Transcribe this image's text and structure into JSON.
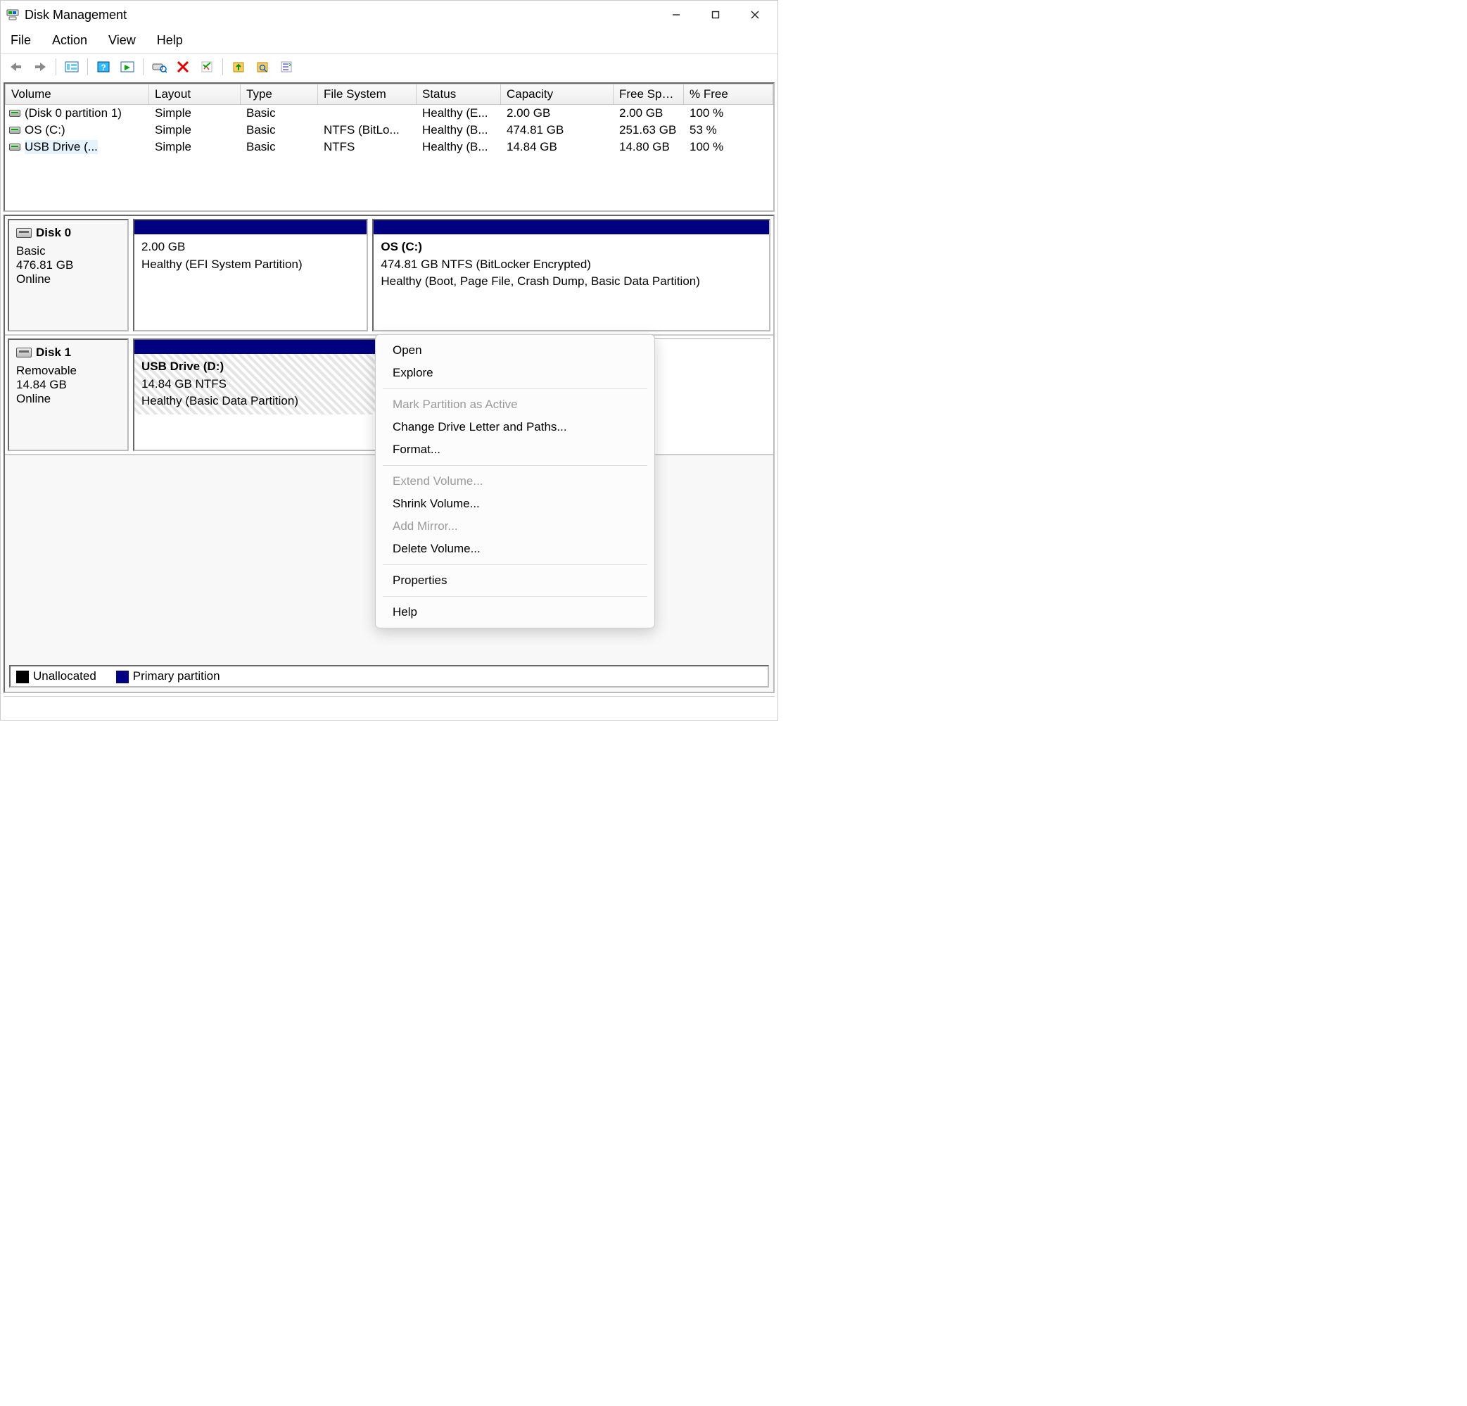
{
  "window": {
    "title": "Disk Management"
  },
  "menubar": [
    "File",
    "Action",
    "View",
    "Help"
  ],
  "columns": [
    "Volume",
    "Layout",
    "Type",
    "File System",
    "Status",
    "Capacity",
    "Free Spa...",
    "% Free"
  ],
  "volumes": [
    {
      "name": "(Disk 0 partition 1)",
      "layout": "Simple",
      "type": "Basic",
      "fs": "",
      "status": "Healthy (E...",
      "capacity": "2.00 GB",
      "free": "2.00 GB",
      "pct": "100 %",
      "selected": false
    },
    {
      "name": "OS (C:)",
      "layout": "Simple",
      "type": "Basic",
      "fs": "NTFS (BitLo...",
      "status": "Healthy (B...",
      "capacity": "474.81 GB",
      "free": "251.63 GB",
      "pct": "53 %",
      "selected": false
    },
    {
      "name": "USB Drive (...",
      "layout": "Simple",
      "type": "Basic",
      "fs": "NTFS",
      "status": "Healthy (B...",
      "capacity": "14.84 GB",
      "free": "14.80 GB",
      "pct": "100 %",
      "selected": true
    }
  ],
  "disks": [
    {
      "name": "Disk 0",
      "basic": "Basic",
      "size": "476.81 GB",
      "status": "Online",
      "parts": [
        {
          "title": "",
          "line1": "2.00 GB",
          "line2": "Healthy (EFI System Partition)",
          "grow": 1
        },
        {
          "title": "OS  (C:)",
          "line1": "474.81 GB NTFS (BitLocker Encrypted)",
          "line2": "Healthy (Boot, Page File, Crash Dump, Basic Data Partition)",
          "grow": 1.7
        }
      ]
    },
    {
      "name": "Disk 1",
      "basic": "Removable",
      "size": "14.84 GB",
      "status": "Online",
      "parts": [
        {
          "title": "USB Drive  (D:)",
          "line1": "14.84 GB NTFS",
          "line2": "Healthy (Basic Data Partition)",
          "grow": 3,
          "hatched": true
        }
      ],
      "trailing_empty": true
    }
  ],
  "legend": {
    "unallocated": "Unallocated",
    "primary": "Primary partition"
  },
  "context_menu": [
    {
      "label": "Open",
      "enabled": true
    },
    {
      "label": "Explore",
      "enabled": true
    },
    {
      "sep": true
    },
    {
      "label": "Mark Partition as Active",
      "enabled": false
    },
    {
      "label": "Change Drive Letter and Paths...",
      "enabled": true
    },
    {
      "label": "Format...",
      "enabled": true
    },
    {
      "sep": true
    },
    {
      "label": "Extend Volume...",
      "enabled": false
    },
    {
      "label": "Shrink Volume...",
      "enabled": true
    },
    {
      "label": "Add Mirror...",
      "enabled": false
    },
    {
      "label": "Delete Volume...",
      "enabled": true
    },
    {
      "sep": true
    },
    {
      "label": "Properties",
      "enabled": true
    },
    {
      "sep": true
    },
    {
      "label": "Help",
      "enabled": true
    }
  ]
}
